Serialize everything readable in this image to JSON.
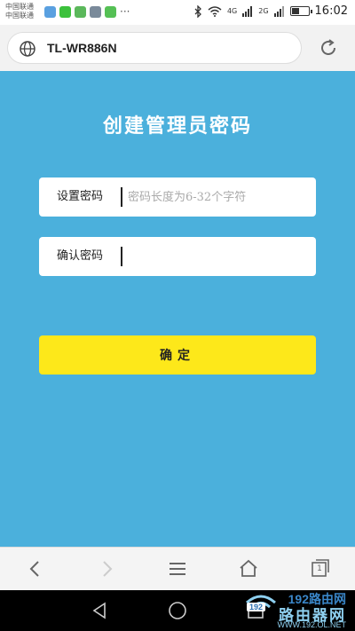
{
  "status_bar": {
    "carrier_line1": "中国联通",
    "carrier_line2": "中国联通",
    "signal_label_1": "4G",
    "signal_label_2": "2G",
    "time": "16:02",
    "notification_icons": [
      "gallery-icon",
      "wechat-icon",
      "app-icon",
      "app-icon",
      "shield-icon",
      "more-icon"
    ]
  },
  "address_bar": {
    "url": "TL-WR886N"
  },
  "page": {
    "title": "创建管理员密码",
    "set_password_label": "设置密码",
    "set_password_placeholder": "密码长度为6-32个字符",
    "confirm_password_label": "确认密码",
    "confirm_password_value": "",
    "confirm_button": "确定"
  },
  "toolbar": {
    "tab_count": "1"
  },
  "watermark": {
    "line1": "192路由网",
    "line2": "路由器网",
    "line3": "WWW.192.OL.NET",
    "badge": "192"
  },
  "colors": {
    "page_bg": "#4bb0dc",
    "button_bg": "#fde81a",
    "field_bg": "#ffffff"
  }
}
